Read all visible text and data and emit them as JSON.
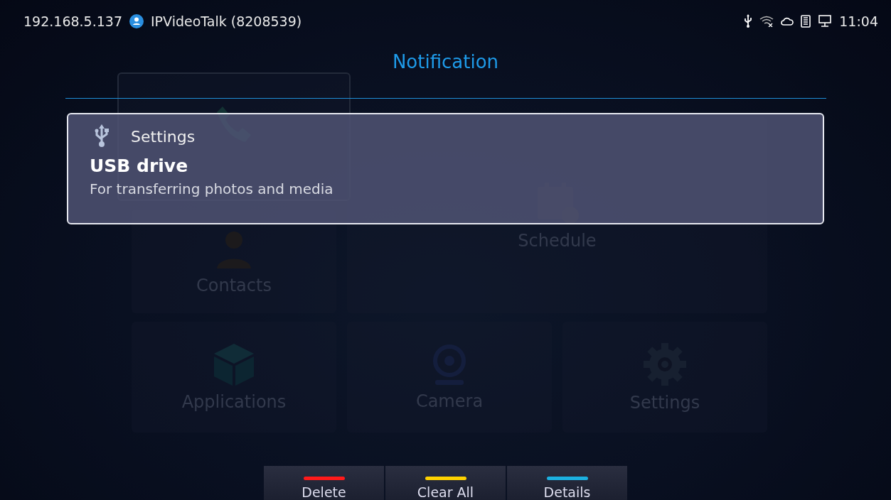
{
  "status_bar": {
    "ip": "192.168.5.137",
    "account": "IPVideoTalk (8208539)",
    "time": "11:04"
  },
  "tiles": [
    {
      "kind": "call"
    },
    {
      "kind": "schedule",
      "label": "Schedule"
    },
    {
      "kind": "contacts",
      "label": "Contacts"
    },
    {
      "kind": "applications",
      "label": "Applications"
    },
    {
      "kind": "camera",
      "label": "Camera"
    },
    {
      "kind": "settings",
      "label": "Settings"
    }
  ],
  "panel": {
    "title": "Notification",
    "notification": {
      "app": "Settings",
      "title": "USB drive",
      "text": "For transferring photos and media"
    }
  },
  "buttons": [
    {
      "label": "Delete",
      "color": "#ff1a1a"
    },
    {
      "label": "Clear All",
      "color": "#ffd200"
    },
    {
      "label": "Details",
      "color": "#1cb0e0"
    }
  ]
}
